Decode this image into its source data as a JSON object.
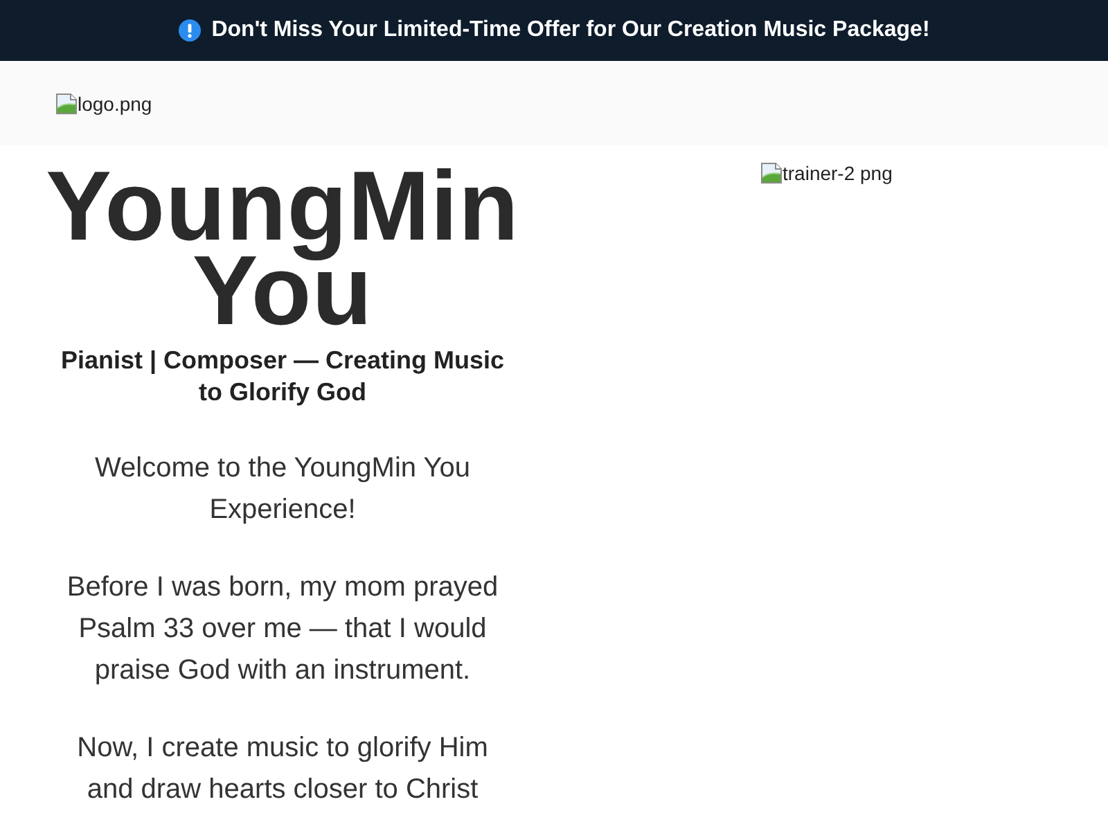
{
  "announcement": {
    "text": "Don't Miss Your Limited-Time Offer for Our Creation Music Package!"
  },
  "header": {
    "logo_alt": "logo.png"
  },
  "hero": {
    "title": "YoungMin You",
    "subtitle": "Pianist | Composer — Creating Music to Glorify God",
    "paragraphs": [
      "Welcome to the YoungMin You Experience!",
      "Before I was born, my mom prayed Psalm 33 over me — that I would praise God with an instrument.",
      "Now, I create music to glorify Him and draw hearts closer to Christ"
    ],
    "image_alt": "trainer-2 png"
  }
}
